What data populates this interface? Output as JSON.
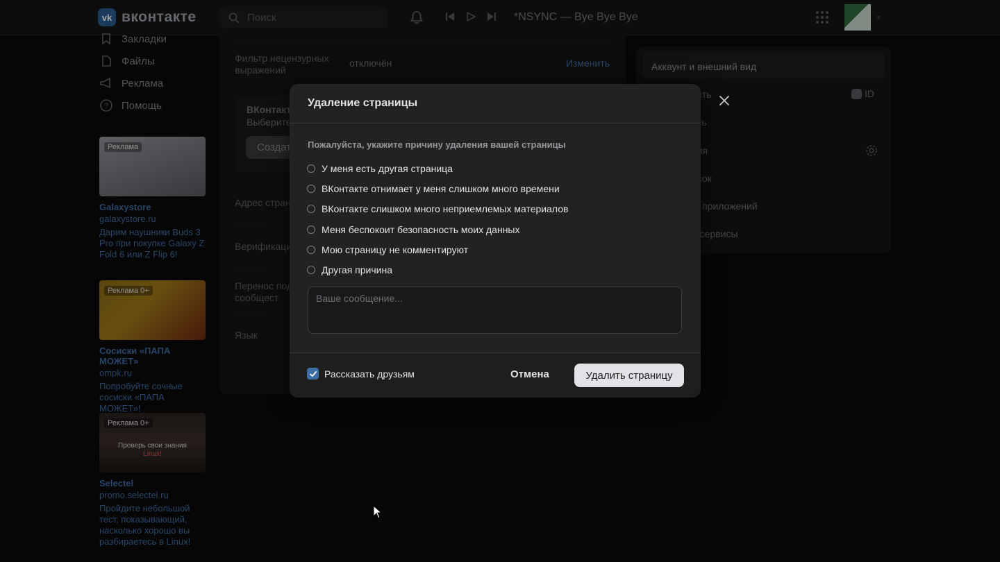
{
  "header": {
    "logo_mark": "vk",
    "logo_text": "вконтакте",
    "search_placeholder": "Поиск",
    "now_playing": "*NSYNC — Bye Bye Bye",
    "icons": [
      "search-icon",
      "bell-icon",
      "prev-track-icon",
      "play-icon",
      "next-track-icon",
      "apps-grid-icon"
    ]
  },
  "left_nav": {
    "items": [
      {
        "label": "Закладки",
        "icon": "bookmark-icon"
      },
      {
        "label": "Файлы",
        "icon": "file-icon"
      },
      {
        "label": "Реклама",
        "icon": "megaphone-icon"
      },
      {
        "label": "Помощь",
        "icon": "help-icon"
      }
    ]
  },
  "ads": [
    {
      "badge": "Реклама",
      "title": "Galaxystore",
      "domain": "galaxystore.ru",
      "text": "Дарим наушники Buds 3 Pro при покупке Galaxy Z Fold 6 или Z Flip 6!"
    },
    {
      "badge": "Реклама 0+",
      "title": "Сосиски «ПАПА МОЖЕТ»",
      "domain": "ompk.ru",
      "text": "Попробуйте сочные сосиски «ПАПА МОЖЕТ»!"
    },
    {
      "badge": "Реклама 0+",
      "overlay": "Проверь свои знания",
      "overlay2": "Linux!",
      "title": "Selectel",
      "domain": "promo.selectel.ru",
      "text": "Пройдите небольшой тест, показывающий, насколько хорошо вы разбираетесь в Linux!"
    }
  ],
  "settings": {
    "filter_label": "Фильтр нецензурных выражений",
    "filter_value": "отключён",
    "filter_action": "Изменить",
    "vk_block_title": "ВКонтакт",
    "vk_block_text": "Выберите",
    "vk_block_button": "Создат",
    "address_label": "Адрес стран",
    "verification_label": "Верификаци",
    "transfer_label": "Перенос под в сообщест",
    "language_label": "Язык"
  },
  "right_menu": {
    "active": "Аккаунт и внешний вид",
    "items": [
      "асть",
      "ить",
      "ния",
      "исок",
      "приложений",
      "е сервисы"
    ],
    "id_badge": "ID"
  },
  "modal": {
    "title": "Удаление страницы",
    "prompt": "Пожалуйста, укажите причину удаления вашей страницы",
    "reasons": [
      "У меня есть другая страница",
      "ВКонтакте отнимает у меня слишком много времени",
      "ВКонтакте слишком много неприемлемых материалов",
      "Меня беспокоит безопасность моих данных",
      "Мою страницу не комментируют",
      "Другая причина"
    ],
    "message_placeholder": "Ваше сообщение...",
    "tell_friends_label": "Рассказать друзьям",
    "tell_friends_checked": true,
    "cancel_label": "Отмена",
    "delete_label": "Удалить страницу"
  },
  "colors": {
    "accent": "#3b6fa5",
    "bg": "#0a0a0a",
    "modal": "#222222"
  }
}
